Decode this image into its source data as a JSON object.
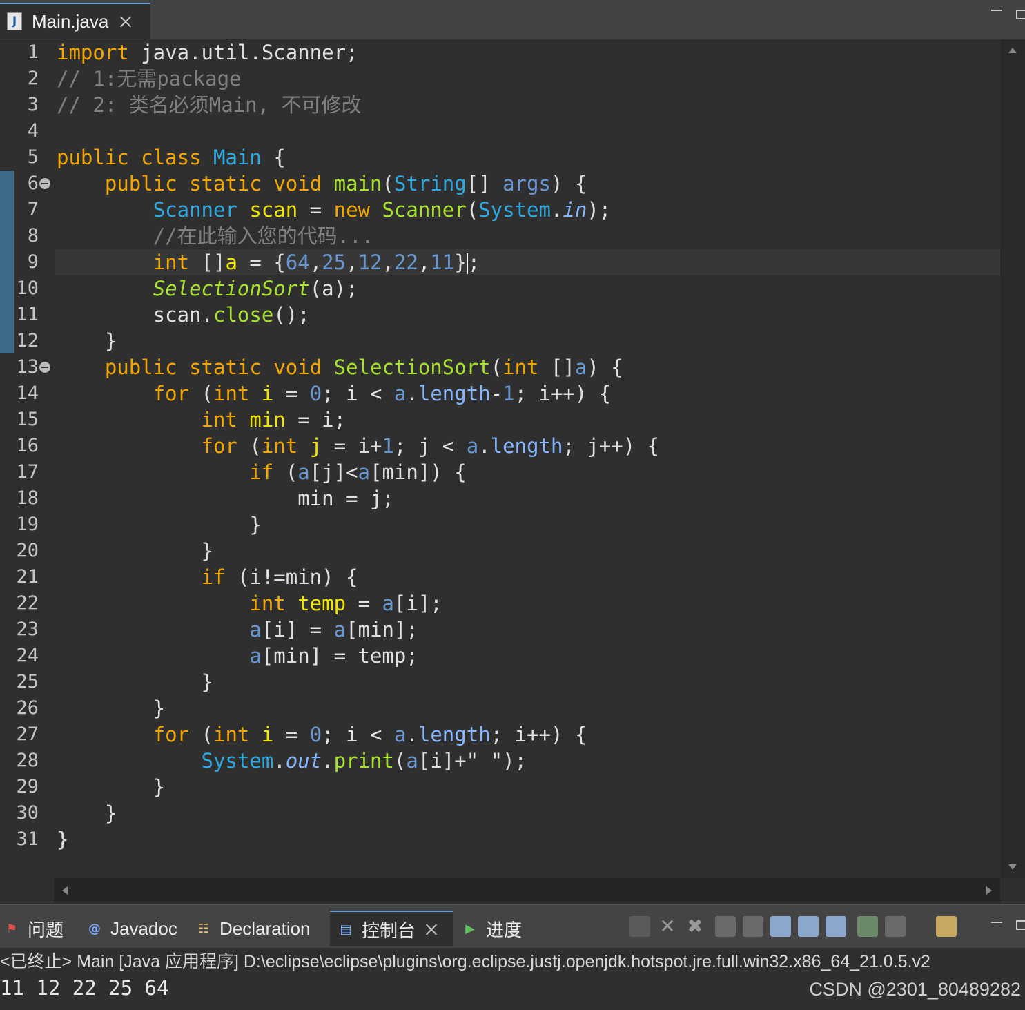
{
  "editor_tab": {
    "icon": "J",
    "title": "Main.java"
  },
  "lines": [
    {
      "n": "1",
      "tokens": [
        [
          "kw",
          "import"
        ],
        [
          "",
          " java.util.Scanner;"
        ]
      ]
    },
    {
      "n": "2",
      "tokens": [
        [
          "cm",
          "// 1:无需package"
        ]
      ]
    },
    {
      "n": "3",
      "tokens": [
        [
          "cm",
          "// 2: 类名必须Main, 不可修改"
        ]
      ]
    },
    {
      "n": "4",
      "tokens": []
    },
    {
      "n": "5",
      "tokens": [
        [
          "kw",
          "public"
        ],
        [
          "",
          " "
        ],
        [
          "kw",
          "class"
        ],
        [
          "",
          " "
        ],
        [
          "ty",
          "Main"
        ],
        [
          "",
          " {"
        ]
      ]
    },
    {
      "n": "6",
      "fold": true,
      "tokens": [
        [
          "",
          "    "
        ],
        [
          "kw",
          "public"
        ],
        [
          "",
          " "
        ],
        [
          "kw",
          "static"
        ],
        [
          "",
          " "
        ],
        [
          "kw",
          "void"
        ],
        [
          "",
          " "
        ],
        [
          "fn",
          "main"
        ],
        [
          "",
          "("
        ],
        [
          "ty",
          "String"
        ],
        [
          "",
          "[] "
        ],
        [
          "nm",
          "args"
        ],
        [
          "",
          ") {"
        ]
      ]
    },
    {
      "n": "7",
      "tokens": [
        [
          "",
          "        "
        ],
        [
          "ty",
          "Scanner"
        ],
        [
          "",
          " "
        ],
        [
          "vr",
          "scan"
        ],
        [
          "",
          " = "
        ],
        [
          "kw",
          "new"
        ],
        [
          "",
          " "
        ],
        [
          "fn",
          "Scanner"
        ],
        [
          "",
          "("
        ],
        [
          "ty",
          "System"
        ],
        [
          "",
          "."
        ],
        [
          "fd it",
          "in"
        ],
        [
          "",
          ");"
        ]
      ]
    },
    {
      "n": "8",
      "tokens": [
        [
          "",
          "        "
        ],
        [
          "cm",
          "//在此输入您的代码..."
        ]
      ]
    },
    {
      "n": "9",
      "caret": true,
      "tokens": [
        [
          "",
          "        "
        ],
        [
          "kw",
          "int"
        ],
        [
          "",
          " []"
        ],
        [
          "vr",
          "a"
        ],
        [
          "",
          " = {"
        ],
        [
          "nm",
          "64"
        ],
        [
          "",
          ","
        ],
        [
          "nm",
          "25"
        ],
        [
          "",
          ","
        ],
        [
          "nm",
          "12"
        ],
        [
          "",
          ","
        ],
        [
          "nm",
          "22"
        ],
        [
          "",
          ","
        ],
        [
          "nm",
          "11"
        ],
        [
          "",
          "}"
        ]
      ]
    },
    {
      "n": "10",
      "tokens": [
        [
          "",
          "        "
        ],
        [
          "fn it",
          "SelectionSort"
        ],
        [
          "",
          "(a);"
        ]
      ]
    },
    {
      "n": "11",
      "tokens": [
        [
          "",
          "        scan."
        ],
        [
          "fn",
          "close"
        ],
        [
          "",
          "();"
        ]
      ]
    },
    {
      "n": "12",
      "tokens": [
        [
          "",
          "    }"
        ]
      ]
    },
    {
      "n": "13",
      "fold": true,
      "tokens": [
        [
          "",
          "    "
        ],
        [
          "kw",
          "public"
        ],
        [
          "",
          " "
        ],
        [
          "kw",
          "static"
        ],
        [
          "",
          " "
        ],
        [
          "kw",
          "void"
        ],
        [
          "",
          " "
        ],
        [
          "fn",
          "SelectionSort"
        ],
        [
          "",
          "("
        ],
        [
          "kw",
          "int"
        ],
        [
          "",
          " []"
        ],
        [
          "nm",
          "a"
        ],
        [
          "",
          ") {"
        ]
      ]
    },
    {
      "n": "14",
      "tokens": [
        [
          "",
          "        "
        ],
        [
          "kw",
          "for"
        ],
        [
          "",
          " ("
        ],
        [
          "kw",
          "int"
        ],
        [
          "",
          " "
        ],
        [
          "vr",
          "i"
        ],
        [
          "",
          " = "
        ],
        [
          "nm",
          "0"
        ],
        [
          "",
          "; i < "
        ],
        [
          "nm",
          "a"
        ],
        [
          "",
          "."
        ],
        [
          "fd",
          "length"
        ],
        [
          "",
          "-"
        ],
        [
          "nm",
          "1"
        ],
        [
          "",
          "; i++) {"
        ]
      ]
    },
    {
      "n": "15",
      "tokens": [
        [
          "",
          "            "
        ],
        [
          "kw",
          "int"
        ],
        [
          "",
          " "
        ],
        [
          "vr",
          "min"
        ],
        [
          "",
          " = i;"
        ]
      ]
    },
    {
      "n": "16",
      "tokens": [
        [
          "",
          "            "
        ],
        [
          "kw",
          "for"
        ],
        [
          "",
          " ("
        ],
        [
          "kw",
          "int"
        ],
        [
          "",
          " "
        ],
        [
          "vr",
          "j"
        ],
        [
          "",
          " = i+"
        ],
        [
          "nm",
          "1"
        ],
        [
          "",
          "; j < "
        ],
        [
          "nm",
          "a"
        ],
        [
          "",
          "."
        ],
        [
          "fd",
          "length"
        ],
        [
          "",
          "; j++) {"
        ]
      ]
    },
    {
      "n": "17",
      "tokens": [
        [
          "",
          "                "
        ],
        [
          "kw",
          "if"
        ],
        [
          "",
          " ("
        ],
        [
          "nm",
          "a"
        ],
        [
          "",
          "[j]<"
        ],
        [
          "nm",
          "a"
        ],
        [
          "",
          "[min]) {"
        ]
      ]
    },
    {
      "n": "18",
      "tokens": [
        [
          "",
          "                    min = j;"
        ]
      ]
    },
    {
      "n": "19",
      "tokens": [
        [
          "",
          "                }"
        ]
      ]
    },
    {
      "n": "20",
      "tokens": [
        [
          "",
          "            }"
        ]
      ]
    },
    {
      "n": "21",
      "tokens": [
        [
          "",
          "            "
        ],
        [
          "kw",
          "if"
        ],
        [
          "",
          " (i!=min) {"
        ]
      ]
    },
    {
      "n": "22",
      "tokens": [
        [
          "",
          "                "
        ],
        [
          "kw",
          "int"
        ],
        [
          "",
          " "
        ],
        [
          "vr",
          "temp"
        ],
        [
          "",
          " = "
        ],
        [
          "nm",
          "a"
        ],
        [
          "",
          "[i];"
        ]
      ]
    },
    {
      "n": "23",
      "tokens": [
        [
          "",
          "                "
        ],
        [
          "nm",
          "a"
        ],
        [
          "",
          "[i] = "
        ],
        [
          "nm",
          "a"
        ],
        [
          "",
          "[min];"
        ]
      ]
    },
    {
      "n": "24",
      "tokens": [
        [
          "",
          "                "
        ],
        [
          "nm",
          "a"
        ],
        [
          "",
          "[min] = temp;"
        ]
      ]
    },
    {
      "n": "25",
      "tokens": [
        [
          "",
          "            }"
        ]
      ]
    },
    {
      "n": "26",
      "tokens": [
        [
          "",
          "        }"
        ]
      ]
    },
    {
      "n": "27",
      "tokens": [
        [
          "",
          "        "
        ],
        [
          "kw",
          "for"
        ],
        [
          "",
          " ("
        ],
        [
          "kw",
          "int"
        ],
        [
          "",
          " "
        ],
        [
          "vr",
          "i"
        ],
        [
          "",
          " = "
        ],
        [
          "nm",
          "0"
        ],
        [
          "",
          "; i < "
        ],
        [
          "nm",
          "a"
        ],
        [
          "",
          "."
        ],
        [
          "fd",
          "length"
        ],
        [
          "",
          "; i++) {"
        ]
      ]
    },
    {
      "n": "28",
      "tokens": [
        [
          "",
          "            "
        ],
        [
          "ty",
          "System"
        ],
        [
          "",
          "."
        ],
        [
          "fd it",
          "out"
        ],
        [
          "",
          "."
        ],
        [
          "fn",
          "print"
        ],
        [
          "",
          "("
        ],
        [
          "nm",
          "a"
        ],
        [
          "",
          "[i]+"
        ],
        [
          "st",
          "\" \""
        ],
        [
          "",
          ");"
        ]
      ]
    },
    {
      "n": "29",
      "tokens": [
        [
          "",
          "        }"
        ]
      ]
    },
    {
      "n": "30",
      "tokens": [
        [
          "",
          "    }"
        ]
      ]
    },
    {
      "n": "31",
      "tokens": [
        [
          "",
          "}"
        ]
      ]
    }
  ],
  "panel": {
    "tabs": [
      {
        "key": "problems",
        "label": "问题",
        "icon": "problems-icon"
      },
      {
        "key": "javadoc",
        "label": "Javadoc",
        "icon": "javadoc-icon"
      },
      {
        "key": "declaration",
        "label": "Declaration",
        "icon": "declaration-icon"
      },
      {
        "key": "console",
        "label": "控制台",
        "icon": "console-icon",
        "active": true
      },
      {
        "key": "progress",
        "label": "进度",
        "icon": "progress-icon"
      }
    ],
    "console_path": "<已终止> Main [Java 应用程序] D:\\eclipse\\eclipse\\plugins\\org.eclipse.justj.openjdk.hotspot.jre.full.win32.x86_64_21.0.5.v2",
    "console_output": "11 12 22 25 64"
  },
  "watermark": "CSDN @2301_80489282",
  "colors": {
    "keyword": "#f2a600",
    "comment": "#808080",
    "type": "#2fa8e0",
    "method": "#a8e22e",
    "variable": "#f0e600",
    "number": "#6897d2"
  }
}
